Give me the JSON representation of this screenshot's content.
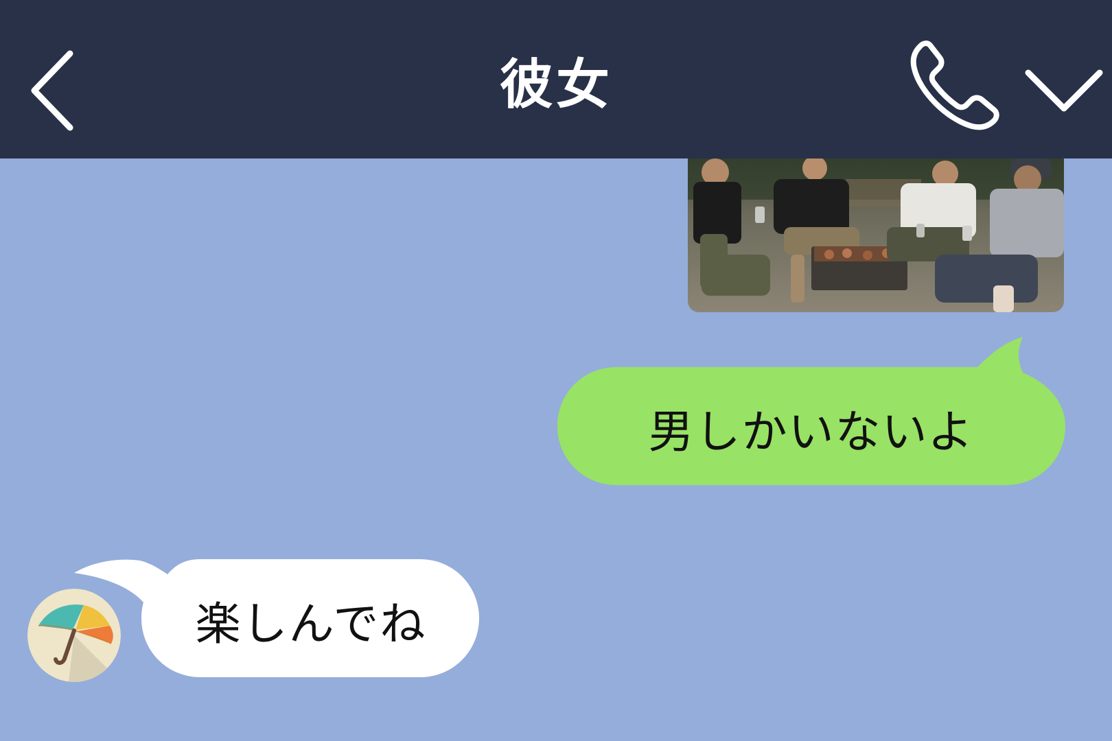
{
  "header": {
    "title": "彼女",
    "back_icon": "chevron-left-icon",
    "call_icon": "phone-icon",
    "menu_icon": "chevron-down-icon",
    "background": "#283148"
  },
  "chat": {
    "background": "#95adda",
    "messages": [
      {
        "sender": "self",
        "type": "image",
        "image": "photo of four men grilling at a campsite barbecue"
      },
      {
        "sender": "self",
        "type": "text",
        "text": "男しかいないよ",
        "bubble_color": "#98e265"
      },
      {
        "sender": "other",
        "type": "text",
        "text": "楽しんでね",
        "bubble_color": "#ffffff",
        "avatar_icon": "umbrella-icon"
      }
    ]
  }
}
